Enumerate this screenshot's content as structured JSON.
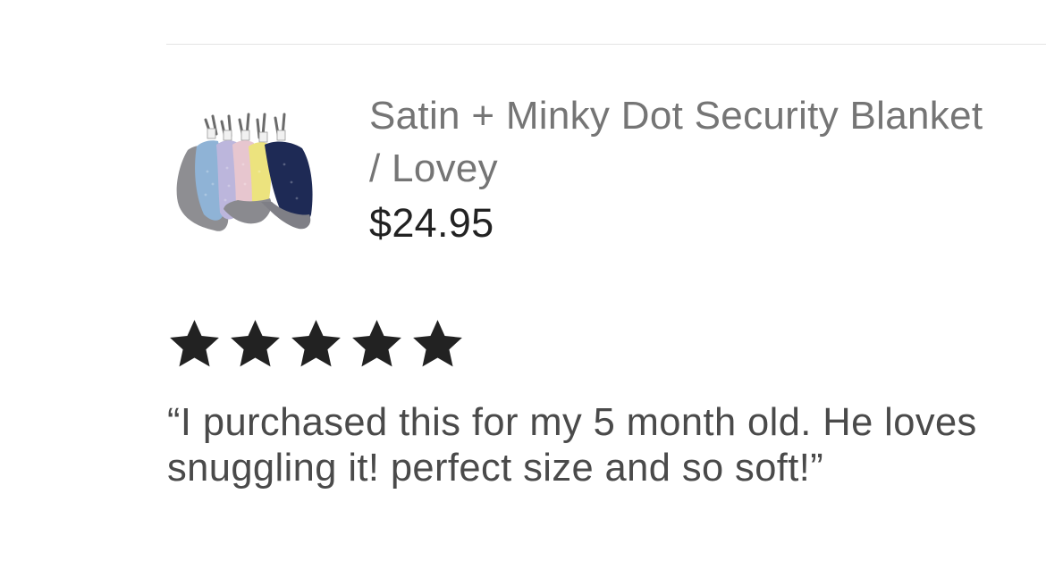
{
  "product": {
    "title": "Satin + Minky Dot Security Blanket / Lovey",
    "price": "$24.95",
    "image_icon": "blanket-product-photo",
    "image_colors": [
      "#8aa9c8",
      "#b8b4d6",
      "#e8c9d2",
      "#ece58a",
      "#1f2a52",
      "#8e8e92"
    ]
  },
  "review": {
    "rating": 5,
    "max_rating": 5,
    "star_icon": "star-icon",
    "star_color": "#222222",
    "text": "“I purchased this for my 5 month old. He loves snuggling it! perfect size and so soft!”"
  }
}
